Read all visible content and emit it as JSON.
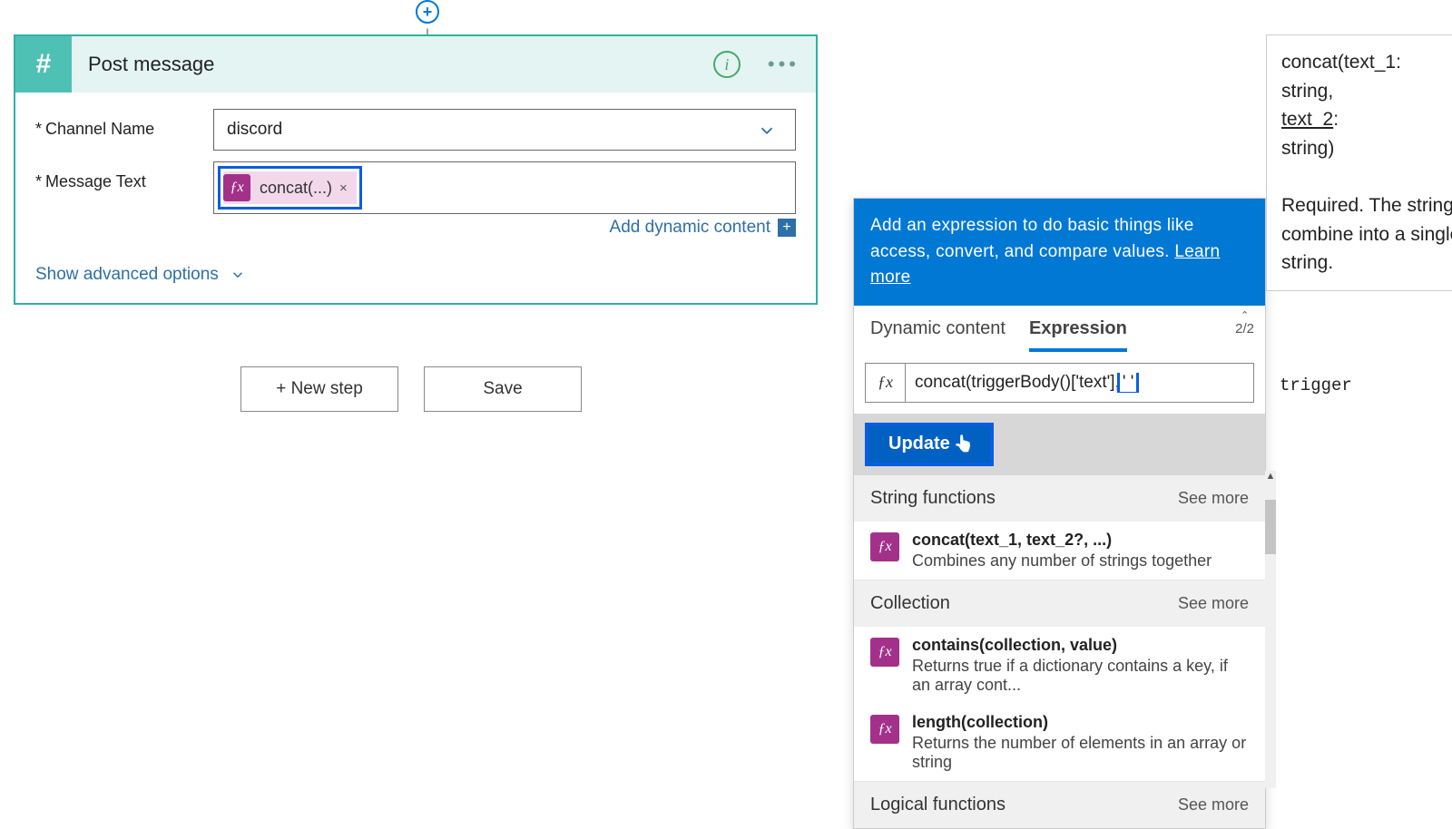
{
  "card": {
    "title": "Post message",
    "fields": {
      "channel_label": "Channel Name",
      "channel_value": "discord",
      "message_label": "Message Text",
      "token_text": "concat(...)",
      "token_close": "×"
    },
    "add_dynamic": "Add dynamic content",
    "advanced": "Show advanced options"
  },
  "buttons": {
    "new_step": "+ New step",
    "save": "Save"
  },
  "expression_panel": {
    "banner_text": "Add an expression to do basic things like access, convert, and compare values. ",
    "learn_more": "Learn more",
    "tabs": {
      "dyn": "Dynamic content",
      "expr": "Expression"
    },
    "page_indicator": "2/2",
    "fx_before": "concat(triggerBody()['text'],",
    "fx_quote": "' '",
    "fx_trailing": "trigger",
    "update": "Update",
    "sections": [
      {
        "title": "String functions",
        "see_more": "See more",
        "items": [
          {
            "sig": "concat(text_1, text_2?, ...)",
            "desc": "Combines any number of strings together"
          }
        ]
      },
      {
        "title": "Collection",
        "see_more": "See more",
        "items": [
          {
            "sig": "contains(collection, value)",
            "desc": "Returns true if a dictionary contains a key, if an array cont..."
          },
          {
            "sig": "length(collection)",
            "desc": "Returns the number of elements in an array or string"
          }
        ]
      },
      {
        "title": "Logical functions",
        "see_more": "See more",
        "items": []
      }
    ]
  },
  "tooltip": {
    "sig_line1": "concat(text_1:",
    "sig_line2": "string,",
    "sig_line3_a": "text_2",
    "sig_line3_b": ":",
    "sig_line4": "string)",
    "desc": "Required. The string to combine into a single string."
  }
}
